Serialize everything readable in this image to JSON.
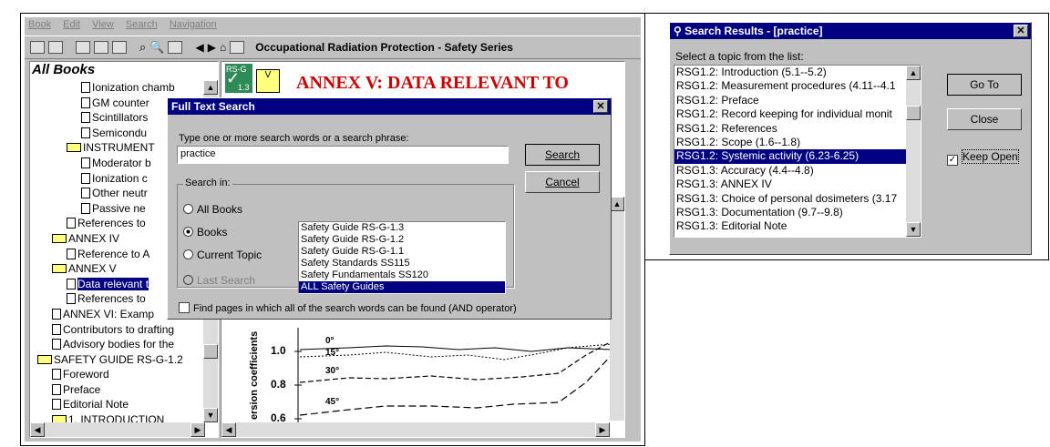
{
  "app": {
    "menu": [
      "Book",
      "Edit",
      "View",
      "Search",
      "Navigation"
    ],
    "toolbar_title": "Occupational Radiation Protection - Safety Series",
    "tree_header": "All Books",
    "tree_items": [
      {
        "label": "Ionization chamb",
        "type": "doc",
        "indent": 56
      },
      {
        "label": "GM counter",
        "type": "doc",
        "indent": 56
      },
      {
        "label": "Scintillators",
        "type": "doc",
        "indent": 56
      },
      {
        "label": "Semicondu",
        "type": "doc",
        "indent": 56
      },
      {
        "label": "INSTRUMENT",
        "type": "folder",
        "indent": 40
      },
      {
        "label": "Moderator b",
        "type": "doc",
        "indent": 56
      },
      {
        "label": "Ionization c",
        "type": "doc",
        "indent": 56
      },
      {
        "label": "Other neutr",
        "type": "doc",
        "indent": 56
      },
      {
        "label": "Passive ne",
        "type": "doc",
        "indent": 56
      },
      {
        "label": "References to",
        "type": "doc",
        "indent": 40
      },
      {
        "label": "ANNEX IV",
        "type": "folder",
        "indent": 24
      },
      {
        "label": "Reference to A",
        "type": "doc",
        "indent": 40
      },
      {
        "label": "ANNEX V",
        "type": "folder",
        "indent": 24
      },
      {
        "label": "Data relevant t",
        "type": "doc",
        "indent": 40,
        "selected": true
      },
      {
        "label": "References to",
        "type": "doc",
        "indent": 40
      },
      {
        "label": "ANNEX VI: Examp",
        "type": "doc",
        "indent": 24
      },
      {
        "label": "Contributors to drafting",
        "type": "doc",
        "indent": 24
      },
      {
        "label": "Advisory bodies for the",
        "type": "doc",
        "indent": 24
      },
      {
        "label": "SAFETY GUIDE RS-G-1.2",
        "type": "folder",
        "indent": 8
      },
      {
        "label": "Foreword",
        "type": "doc",
        "indent": 24
      },
      {
        "label": "Preface",
        "type": "doc",
        "indent": 24
      },
      {
        "label": "Editorial Note",
        "type": "doc",
        "indent": 24
      },
      {
        "label": "1. INTRODUCTION",
        "type": "folder",
        "indent": 24
      }
    ],
    "doc_heading": "ANNEX V: DATA RELEVANT TO",
    "badge_top": "RS-G",
    "badge_bottom": "1.3",
    "badge_v": "V",
    "chart_ylabel": "ersion coefficients",
    "chart_yticks": [
      "1.0",
      "0.8",
      "0.6"
    ],
    "chart_angles": [
      "0°",
      "15°",
      "30°",
      "45°"
    ]
  },
  "fts": {
    "title": "Full Text Search",
    "prompt": "Type one or more search words or a search phrase:",
    "query": "practice",
    "search_label": "Search",
    "cancel_label": "Cancel",
    "search_in_label": "Search in:",
    "radio_all": "All Books",
    "radio_books": "Books",
    "radio_current": "Current Topic",
    "radio_last": "Last Search",
    "books": [
      "Safety Guide RS-G-1.3",
      "Safety Guide RS-G-1.2",
      "Safety Guide RS-G-1.1",
      "Safety Standards SS115",
      "Safety Fundamentals SS120",
      "ALL Safety Guides"
    ],
    "and_label": "Find pages in which all of the search words can be found (AND operator)"
  },
  "sr": {
    "title": "Search Results - [practice]",
    "prompt": "Select a topic from the list:",
    "results": [
      "RSG1.2: Introduction (5.1--5.2)",
      "RSG1.2: Measurement procedures (4.11--4.1",
      "RSG1.2: Preface",
      "RSG1.2: Record keeping for individual monit",
      "RSG1.2: References",
      "RSG1.2: Scope (1.6--1.8)",
      "RSG1.2: Systemic activity (6.23-6.25)",
      "RSG1.3: Accuracy (4.4--4.8)",
      "RSG1.3: ANNEX IV",
      "RSG1.3: Choice of personal dosimeters (3.17",
      "RSG1.3: Documentation (9.7--9.8)",
      "RSG1.3: Editorial Note"
    ],
    "selected_index": 6,
    "goto_label": "Go To",
    "close_label": "Close",
    "keep_open_label": "Keep Open"
  }
}
